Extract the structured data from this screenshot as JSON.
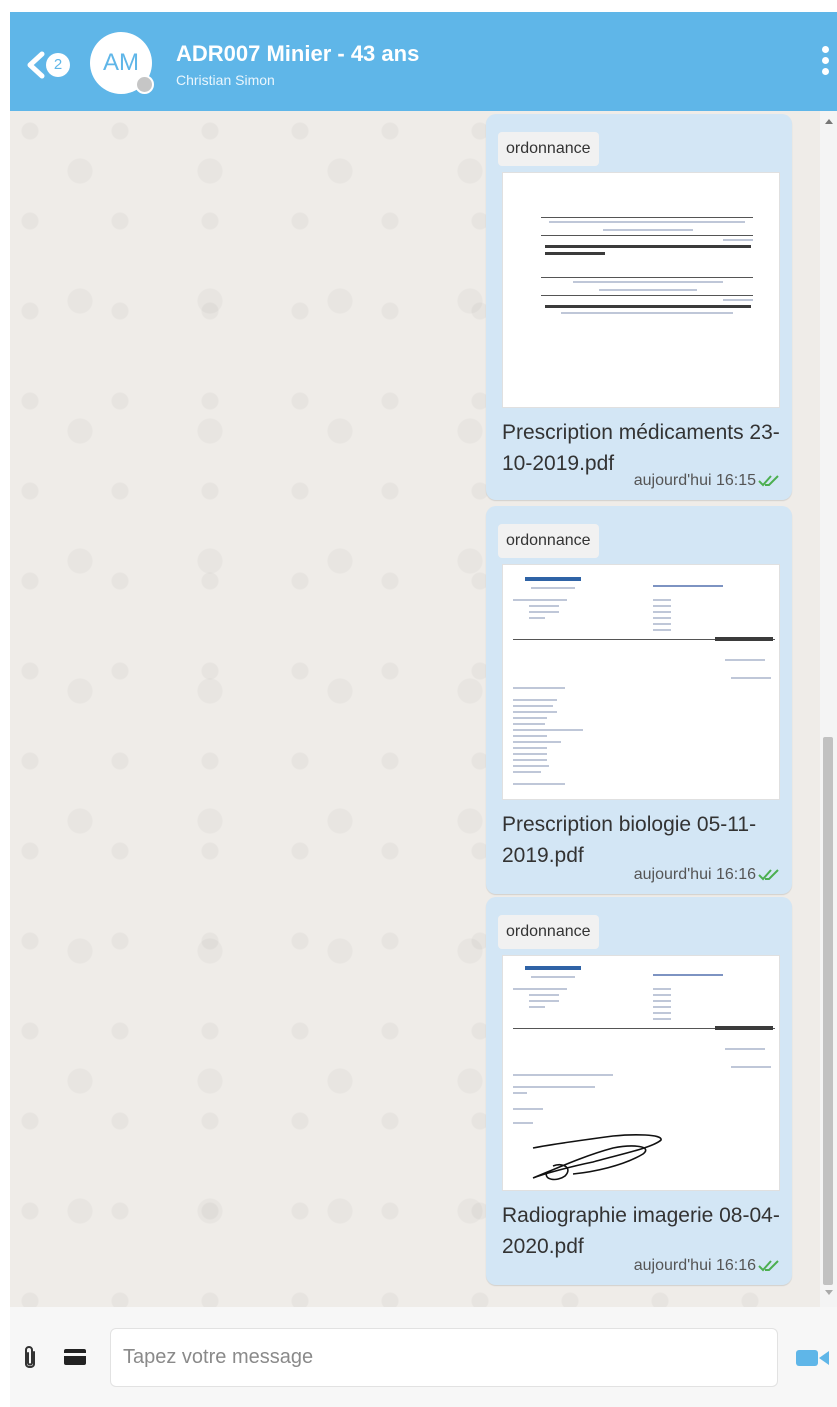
{
  "header": {
    "back_badge": "2",
    "avatar_initials": "AM",
    "title": "ADR007 Minier - 43 ans",
    "subtitle": "Christian Simon"
  },
  "messages": [
    {
      "tag": "ordonnance",
      "filename": "Prescription médicaments 23-10-2019.pdf",
      "time": "aujourd'hui 16:15",
      "preview_text": {
        "line1": "Prescription(s) relative(s) au traitement de l'affection de longue durée reconnue (liste ou hors liste)",
        "line2": "(AFFECTION EXONÉRANTE)",
        "date1": "23/10/2019",
        "drug1": "Paracétamol 1000 mg poudre pour solution buvable en sachet (DOLIPRANE 1000MG SACHET 1)",
        "header2": "Prescriptions sans rapport avec l'affection de longue durée",
        "line4": "(MALADIES INTERCURRENTES)",
        "date2": "23/10/2019",
        "drug2": "Amoxicilline 500 mg gélule (AMOXICILLINE 500MG MYLAN GELULE 1)",
        "posology": "1 à 2 gélules 2 à 3 fois par jour pendant mois maxi selon un certain délai"
      }
    },
    {
      "tag": "ordonnance",
      "filename": "Prescription biologie 05-11-2019.pdf",
      "time": "aujourd'hui 16:16",
      "preview_text": {
        "doctor": "Dr Prénom NOM",
        "specialty": "Médecin généraliste",
        "consult": "Consultations sur rendez-vous",
        "address": "30 rue principale",
        "postcode": "0000 LESSERS",
        "phone": "Tél. : 0101010101",
        "fax": "Fax :",
        "hours": "Lundi\nMardi\nMercredi\nJeudi\nVendredi\nSamedi",
        "patient": "Minier ADR007",
        "age": "Adulte, 43 ans",
        "date": "Le 05/11/2019",
        "section1": "* Prélèvement de : Sang",
        "tests": "- Taux de prothrombine\n- Bilirubine libre\n- Bilirubine conjuguée\n- SGOT ASAT\n- SGPT ALAT\n- Gamma Glutamyl Transpeptidase\n- Amylasémie\n- Phosphatases alcalines\n- Anti-HAV IgG\n- Anticorps anti-HBc\n- Anticorps anti-HBs\n- Anticorps anti-HCV\n- Antigène HBs",
        "section2": "* Prélèvement de : Urines"
      }
    },
    {
      "tag": "ordonnance",
      "filename": "Radiographie imagerie 08-04-2020.pdf",
      "time": "aujourd'hui 16:16",
      "preview_text": {
        "doctor": "Dr Prénom NOM",
        "specialty": "Médecin généraliste",
        "consult": "Consultations sur rendez-vous",
        "address": "30 rue principale",
        "postcode": "0000 LESSERS",
        "phone": "Tél. : 0101010101",
        "fax": "Fax :",
        "hours": "Lundi\nMardi\nMercredi\nJeudi\nVendredi\nSamedi",
        "patient": "Minier ADR007",
        "age": "Adulte, 43 ans",
        "date": "Le 08/04/2020",
        "item1": "- Radiographie du Rachis dorsal face/profil",
        "item2": "- Radiographie des Hanches profil",
        "item2b": "Droit",
        "urgency": "En urgence",
        "ald": "ALD: (oui)"
      }
    }
  ],
  "composer": {
    "placeholder": "Tapez votre message"
  },
  "colors": {
    "header": "#5fb6e8",
    "bubble": "#d3e6f5",
    "check": "#4caf50",
    "video": "#5fb6e8"
  },
  "icons": [
    "back-chevron-icon",
    "more-vert-icon",
    "double-check-icon",
    "paperclip-icon",
    "card-icon",
    "video-camera-icon"
  ]
}
